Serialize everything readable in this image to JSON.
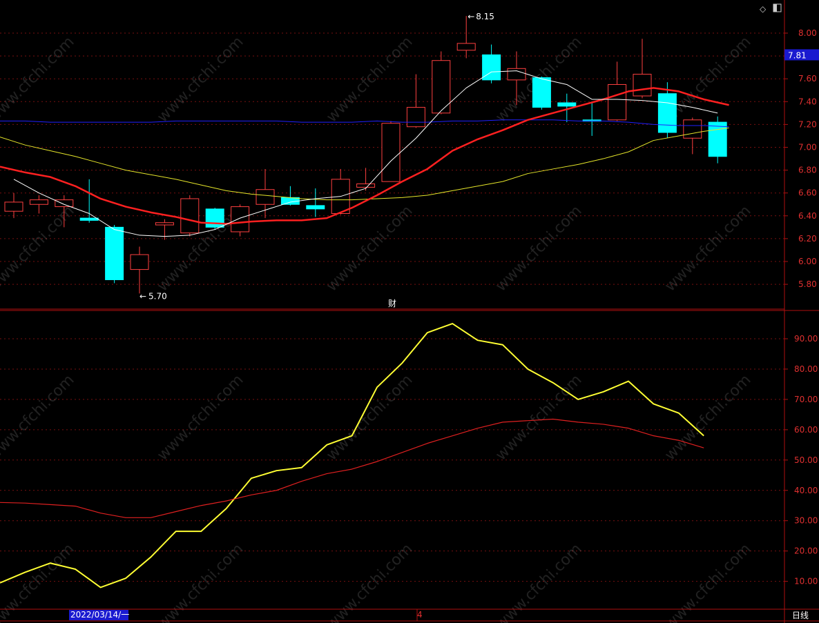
{
  "chart_data": [
    {
      "type": "candlestick",
      "ylim": [
        5.55,
        8.25
      ],
      "yticks": [
        "8.00",
        "7.80",
        "7.60",
        "7.40",
        "7.20",
        "7.00",
        "6.80",
        "6.60",
        "6.40",
        "6.20",
        "6.00",
        "5.80"
      ],
      "current_price": "7.81",
      "high_label": "8.15",
      "low_label": "5.70",
      "event_marker": "财",
      "candles": [
        {
          "o": 6.44,
          "c": 6.52,
          "h": 6.6,
          "l": 6.38
        },
        {
          "o": 6.5,
          "c": 6.54,
          "h": 6.58,
          "l": 6.42
        },
        {
          "o": 6.48,
          "c": 6.54,
          "h": 6.58,
          "l": 6.3
        },
        {
          "o": 6.38,
          "c": 6.36,
          "h": 6.72,
          "l": 6.34
        },
        {
          "o": 6.3,
          "c": 5.84,
          "h": 6.32,
          "l": 5.81
        },
        {
          "o": 5.93,
          "c": 6.06,
          "h": 6.13,
          "l": 5.72
        },
        {
          "o": 6.32,
          "c": 6.34,
          "h": 6.37,
          "l": 6.19
        },
        {
          "o": 6.25,
          "c": 6.55,
          "h": 6.58,
          "l": 6.22
        },
        {
          "o": 6.46,
          "c": 6.3,
          "h": 6.47,
          "l": 6.28
        },
        {
          "o": 6.26,
          "c": 6.48,
          "h": 6.5,
          "l": 6.22
        },
        {
          "o": 6.5,
          "c": 6.63,
          "h": 6.81,
          "l": 6.38
        },
        {
          "o": 6.56,
          "c": 6.5,
          "h": 6.66,
          "l": 6.49
        },
        {
          "o": 6.49,
          "c": 6.46,
          "h": 6.64,
          "l": 6.39
        },
        {
          "o": 6.42,
          "c": 6.72,
          "h": 6.81,
          "l": 6.41
        },
        {
          "o": 6.65,
          "c": 6.68,
          "h": 6.82,
          "l": 6.62
        },
        {
          "o": 6.7,
          "c": 7.21,
          "h": 7.23,
          "l": 6.7
        },
        {
          "o": 7.18,
          "c": 7.35,
          "h": 7.64,
          "l": 7.17
        },
        {
          "o": 7.3,
          "c": 7.76,
          "h": 7.84,
          "l": 7.29
        },
        {
          "o": 7.85,
          "c": 7.91,
          "h": 8.15,
          "l": 7.78
        },
        {
          "o": 7.81,
          "c": 7.59,
          "h": 7.9,
          "l": 7.56
        },
        {
          "o": 7.59,
          "c": 7.69,
          "h": 7.84,
          "l": 7.37
        },
        {
          "o": 7.61,
          "c": 7.35,
          "h": 7.62,
          "l": 7.33
        },
        {
          "o": 7.39,
          "c": 7.36,
          "h": 7.47,
          "l": 7.22
        },
        {
          "o": 7.24,
          "c": 7.23,
          "h": 7.4,
          "l": 7.1
        },
        {
          "o": 7.24,
          "c": 7.55,
          "h": 7.75,
          "l": 7.23
        },
        {
          "o": 7.45,
          "c": 7.64,
          "h": 7.95,
          "l": 7.43
        },
        {
          "o": 7.47,
          "c": 7.13,
          "h": 7.57,
          "l": 7.08
        },
        {
          "o": 7.08,
          "c": 7.24,
          "h": 7.26,
          "l": 6.94
        },
        {
          "o": 7.22,
          "c": 6.92,
          "h": 7.27,
          "l": 6.86
        }
      ],
      "ma_short": [
        6.72,
        6.6,
        6.5,
        6.42,
        6.28,
        6.23,
        6.22,
        6.23,
        6.28,
        6.38,
        6.45,
        6.52,
        6.55,
        6.57,
        6.64,
        6.88,
        7.08,
        7.32,
        7.52,
        7.66,
        7.67,
        7.6,
        7.55,
        7.42,
        7.42,
        7.41,
        7.39,
        7.35,
        7.3
      ],
      "ma_mid": [
        6.83,
        6.78,
        6.74,
        6.66,
        6.55,
        6.48,
        6.43,
        6.39,
        6.34,
        6.33,
        6.35,
        6.36,
        6.36,
        6.38,
        6.47,
        6.58,
        6.7,
        6.81,
        6.97,
        7.07,
        7.15,
        7.24,
        7.3,
        7.36,
        7.42,
        7.49,
        7.52,
        7.49,
        7.42,
        7.37
      ],
      "ma_long": [
        7.09,
        7.02,
        6.97,
        6.92,
        6.86,
        6.8,
        6.76,
        6.72,
        6.67,
        6.62,
        6.59,
        6.57,
        6.55,
        6.54,
        6.54,
        6.55,
        6.56,
        6.58,
        6.62,
        6.66,
        6.7,
        6.77,
        6.81,
        6.85,
        6.9,
        6.96,
        7.06,
        7.1,
        7.14,
        7.17
      ],
      "ma_flat": [
        7.23,
        7.23,
        7.22,
        7.22,
        7.22,
        7.22,
        7.22,
        7.23,
        7.23,
        7.23,
        7.23,
        7.23,
        7.22,
        7.22,
        7.22,
        7.23,
        7.22,
        7.22,
        7.23,
        7.23,
        7.24,
        7.24,
        7.24,
        7.23,
        7.23,
        7.22,
        7.2,
        7.19,
        7.19,
        7.18
      ]
    },
    {
      "type": "line",
      "ylim": [
        5,
        99
      ],
      "yticks": [
        "90.00",
        "80.00",
        "70.00",
        "60.00",
        "50.00",
        "40.00",
        "30.00",
        "20.00",
        "10.00"
      ],
      "series": [
        {
          "color": "#ffff33",
          "values": [
            9.5,
            13,
            16,
            14,
            8,
            11,
            18,
            26.5,
            26.5,
            34,
            44,
            46.5,
            47.5,
            55,
            58,
            74,
            82,
            92,
            95,
            89.5,
            88,
            80,
            75.5,
            70,
            72.5,
            76,
            68.5,
            65.5,
            58
          ]
        },
        {
          "color": "#e02020",
          "values": [
            36,
            35.8,
            35.3,
            34.8,
            32.5,
            31,
            31,
            33,
            35,
            36.5,
            38.5,
            40,
            43,
            45.5,
            47,
            49.5,
            52.5,
            55.5,
            58,
            60.5,
            62.5,
            63,
            63.5,
            62.5,
            61.8,
            60.5,
            58,
            56.5,
            54
          ]
        }
      ]
    }
  ],
  "x_axis": {
    "date_label": "2022/03/14/一",
    "marker": "4"
  },
  "period_label": "日线",
  "watermark": "www.cfchi.com"
}
